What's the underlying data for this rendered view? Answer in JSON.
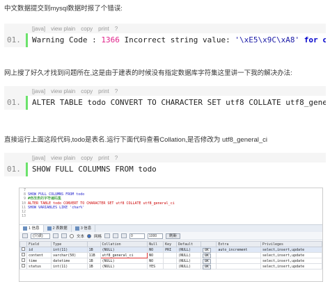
{
  "intro_text": "中文数据提交到mysql数据时报了个错误:",
  "code1": {
    "toolbar": [
      "[java]",
      "view plain",
      "copy",
      "print",
      "?"
    ],
    "line_no": "01.",
    "parts": [
      "Warning Code : ",
      "1366",
      " Incorrect string value: ",
      "'\\xE5\\x9C\\xA8'",
      " for column"
    ]
  },
  "mid_text": "网上搜了好久才找到问题所在,这是由于建表的时候没有指定数据库字符集这里讲一下我的解决办法:",
  "code2": {
    "toolbar": [
      "[java]",
      "view plain",
      "copy",
      "print",
      "?"
    ],
    "line_no": "01.",
    "text": "ALTER TABLE todo CONVERT TO CHARACTER SET utf8 COLLATE utf8_general_c"
  },
  "run_text": "直接运行上面这段代码,todo是表名.运行下面代码查看Collation,是否修改为 utf8_general_ci",
  "code3": {
    "toolbar": [
      "[java]",
      "view plain",
      "copy",
      "print",
      "?"
    ],
    "line_no": "01.",
    "text": "SHOW FULL COLUMNS FROM todo"
  },
  "screenshot": {
    "editor_lines": [
      {
        "no": "7",
        "text": ""
      },
      {
        "no": "8",
        "text": "SHOW FULL COLUMNS FROM todo"
      },
      {
        "no": "9",
        "text": "#修改表的字符编码集"
      },
      {
        "no": "10",
        "text": "ALTER TABLE todo CONVERT TO CHARACTER SET utf8 COLLATE utf8_general_ci"
      },
      {
        "no": "11",
        "text": "SHOW VARIABLES LIKE 'char%'"
      },
      {
        "no": "12",
        "text": ""
      },
      {
        "no": "13",
        "text": ""
      }
    ],
    "tabs": [
      {
        "label": "1 信息"
      },
      {
        "label": "2 表数据"
      },
      {
        "label": "3 信息"
      }
    ],
    "filter": {
      "select": "(只读)",
      "radio1": "文本",
      "radio2": "网格",
      "num1": "0",
      "num2": "1000",
      "refresh": "刷新"
    },
    "columns": [
      "Field",
      "Type",
      "",
      "Collation",
      "Null",
      "Key",
      "Default",
      "",
      "Extra",
      "Privileges"
    ],
    "rows": [
      [
        "id",
        "int(11)",
        "1B",
        "(NULL)",
        "NO",
        "PRI",
        "(NULL)",
        "0K",
        "auto_increment",
        "select,insert,update"
      ],
      [
        "content",
        "varchar(50)",
        "11B",
        "utf8_general_ci",
        "NO",
        "",
        "(NULL)",
        "0K",
        "",
        "select,insert,update"
      ],
      [
        "time",
        "datetime",
        "1B",
        "(NULL)",
        "NO",
        "",
        "(NULL)",
        "0K",
        "",
        "select,insert,update"
      ],
      [
        "status",
        "int(11)",
        "1B",
        "(NULL)",
        "YES",
        "",
        "(NULL)",
        "0K",
        "",
        "select,insert,update"
      ]
    ]
  }
}
